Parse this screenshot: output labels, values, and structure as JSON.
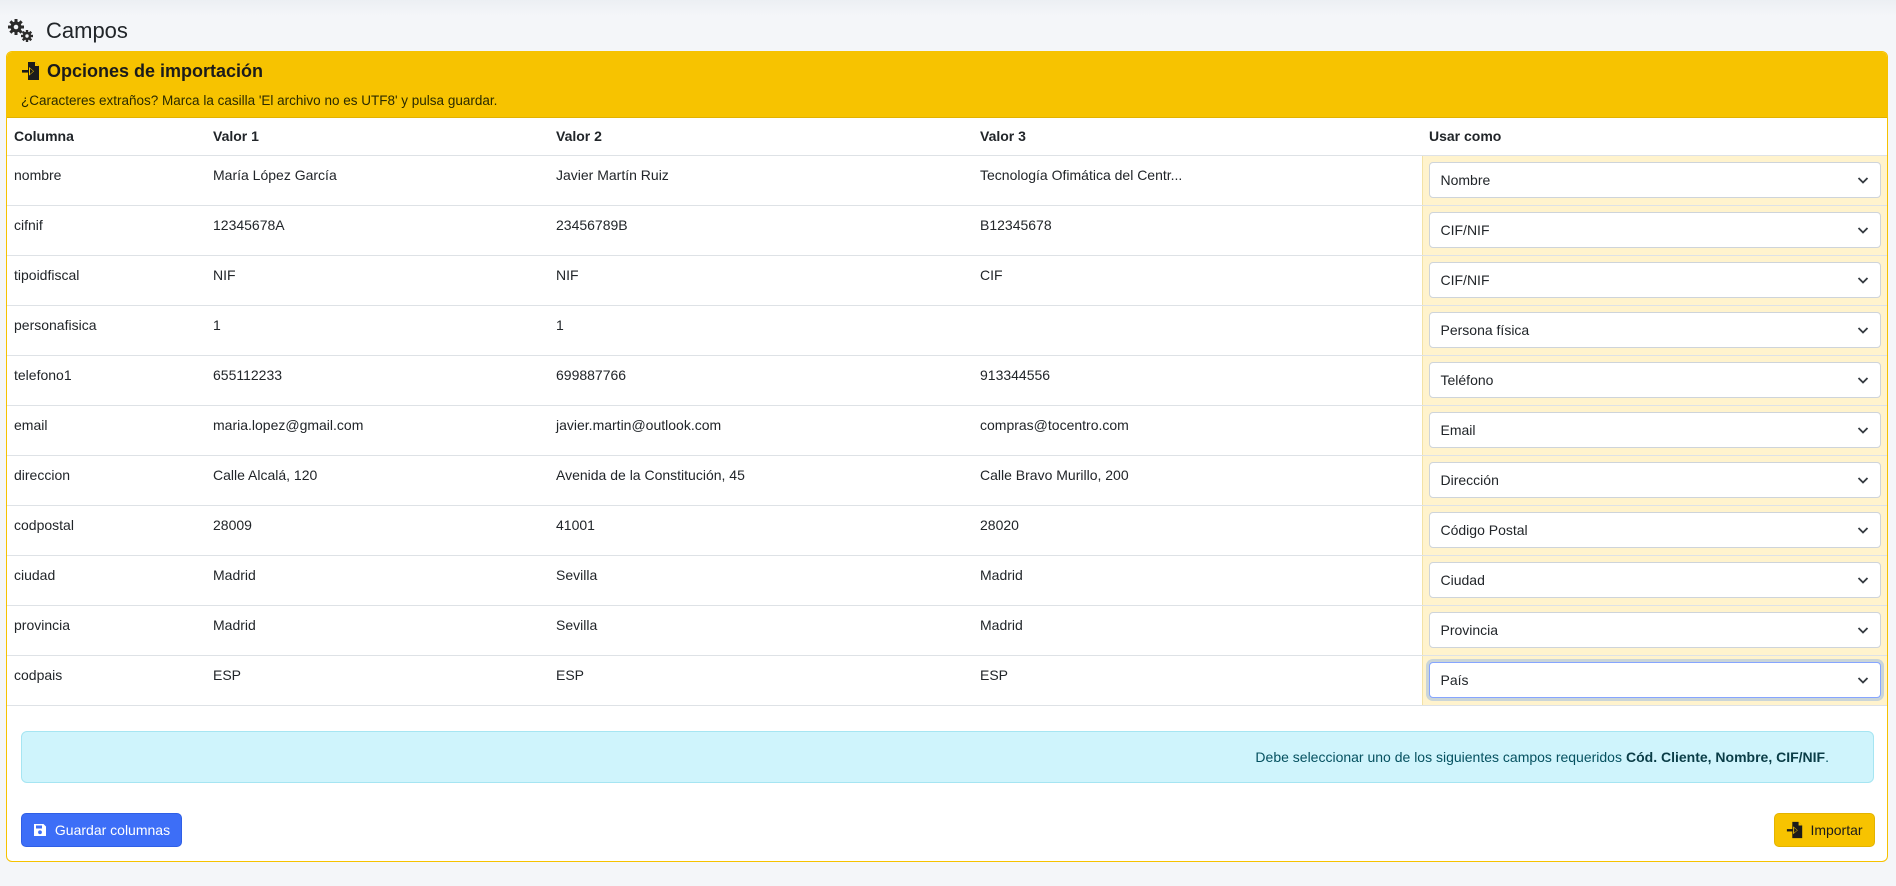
{
  "page": {
    "title": "Campos"
  },
  "card": {
    "title": "Opciones de importación",
    "subtitle": "¿Caracteres extraños? Marca la casilla 'El archivo no es UTF8' y pulsa guardar."
  },
  "table": {
    "headers": [
      "Columna",
      "Valor 1",
      "Valor 2",
      "Valor 3",
      "Usar como"
    ],
    "rows": [
      {
        "columna": "nombre",
        "v1": "María López García",
        "v2": "Javier Martín Ruiz",
        "v3": "Tecnología Ofimática del Centr...",
        "usar": "Nombre"
      },
      {
        "columna": "cifnif",
        "v1": "12345678A",
        "v2": "23456789B",
        "v3": "B12345678",
        "usar": "CIF/NIF"
      },
      {
        "columna": "tipoidfiscal",
        "v1": "NIF",
        "v2": "NIF",
        "v3": "CIF",
        "usar": "CIF/NIF"
      },
      {
        "columna": "personafisica",
        "v1": "1",
        "v2": "1",
        "v3": "",
        "usar": "Persona física"
      },
      {
        "columna": "telefono1",
        "v1": "655112233",
        "v2": "699887766",
        "v3": "913344556",
        "usar": "Teléfono"
      },
      {
        "columna": "email",
        "v1": "maria.lopez@gmail.com",
        "v2": "javier.martin@outlook.com",
        "v3": "compras@tocentro.com",
        "usar": "Email"
      },
      {
        "columna": "direccion",
        "v1": "Calle Alcalá, 120",
        "v2": "Avenida de la Constitución, 45",
        "v3": "Calle Bravo Murillo, 200",
        "usar": "Dirección"
      },
      {
        "columna": "codpostal",
        "v1": "28009",
        "v2": "41001",
        "v3": "28020",
        "usar": "Código Postal"
      },
      {
        "columna": "ciudad",
        "v1": "Madrid",
        "v2": "Sevilla",
        "v3": "Madrid",
        "usar": "Ciudad"
      },
      {
        "columna": "provincia",
        "v1": "Madrid",
        "v2": "Sevilla",
        "v3": "Madrid",
        "usar": "Provincia"
      },
      {
        "columna": "codpais",
        "v1": "ESP",
        "v2": "ESP",
        "v3": "ESP",
        "usar": "País"
      }
    ]
  },
  "alert": {
    "text": "Debe seleccionar uno de los siguientes campos requeridos",
    "fields": "Cód. Cliente, Nombre, CIF/NIF",
    "end": "."
  },
  "buttons": {
    "save_label": "Guardar columnas",
    "import_label": "Importar"
  },
  "icons": {
    "title": "gears-icon",
    "card": "file-import-icon",
    "save": "floppy-disk-icon",
    "import": "file-import-icon",
    "select": "chevron-down-icon"
  },
  "colors": {
    "warning": "#f7c300",
    "primary": "#3d6ef7",
    "info_bg": "#cff4fc",
    "usar_bg": "#fff3cd"
  }
}
